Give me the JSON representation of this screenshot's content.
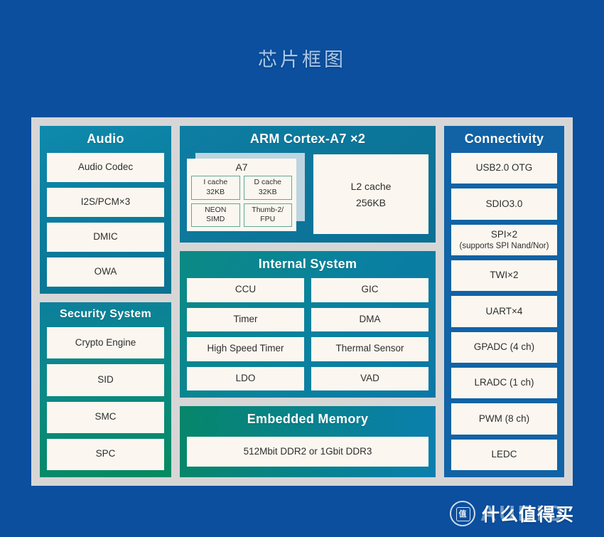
{
  "page": {
    "title": "芯片框图",
    "background_color": "#0b4f9e",
    "title_color": "#a9c8e8"
  },
  "blocks": {
    "audio": {
      "title": "Audio",
      "accent": "#0b7b9c",
      "items": [
        "Audio Codec",
        "I2S/PCM×3",
        "DMIC",
        "OWA"
      ]
    },
    "security": {
      "title": "Security System",
      "accent": "#068a5f",
      "items": [
        "Crypto Engine",
        "SID",
        "SMC",
        "SPC"
      ]
    },
    "arm": {
      "title": "ARM Cortex-A7 ×2",
      "accent": "#0c7599",
      "core": {
        "label": "A7",
        "cells": [
          {
            "line1": "I cache",
            "line2": "32KB"
          },
          {
            "line1": "D cache",
            "line2": "32KB"
          },
          {
            "line1": "NEON",
            "line2": "SIMD"
          },
          {
            "line1": "Thumb-2/",
            "line2": "FPU"
          }
        ]
      },
      "l2": {
        "line1": "L2 cache",
        "line2": "256KB"
      }
    },
    "internal": {
      "title": "Internal System",
      "accent": "#0a81a0",
      "items": [
        "CCU",
        "GIC",
        "Timer",
        "DMA",
        "High Speed Timer",
        "Thermal Sensor",
        "LDO",
        "VAD"
      ]
    },
    "memory": {
      "title": "Embedded Memory",
      "accent": "#088291",
      "items": [
        "512Mbit DDR2 or 1Gbit DDR3"
      ]
    },
    "connectivity": {
      "title": "Connectivity",
      "accent": "#1163a6",
      "items": [
        {
          "line1": "USB2.0 OTG",
          "line2": ""
        },
        {
          "line1": "SDIO3.0",
          "line2": ""
        },
        {
          "line1": "SPI×2",
          "line2": "(supports SPI Nand/Nor)"
        },
        {
          "line1": "TWI×2",
          "line2": ""
        },
        {
          "line1": "UART×4",
          "line2": ""
        },
        {
          "line1": "GPADC (4 ch)",
          "line2": ""
        },
        {
          "line1": "LRADC (1 ch)",
          "line2": ""
        },
        {
          "line1": "PWM (8 ch)",
          "line2": ""
        },
        {
          "line1": "LEDC",
          "line2": ""
        }
      ]
    }
  },
  "watermark": {
    "badge_text": "值",
    "audio_text": "AUDIO",
    "brand_text": "什么值得买"
  }
}
